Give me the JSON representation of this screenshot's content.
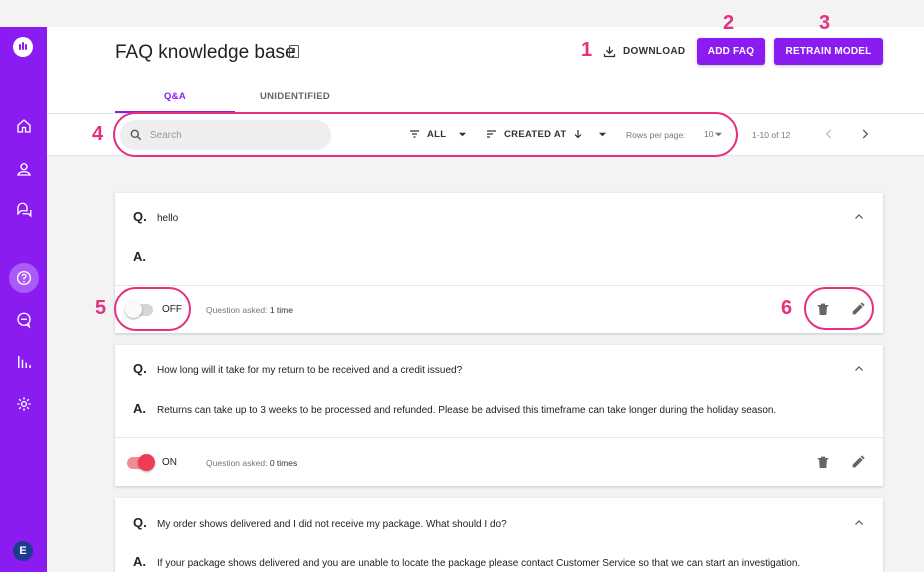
{
  "app": {
    "avatar_letter": "E"
  },
  "sidebar": {
    "items": [
      {
        "icon": "home-icon",
        "active": false
      },
      {
        "icon": "contacts-icon",
        "active": false
      },
      {
        "icon": "chats-icon",
        "active": false
      },
      {
        "icon": "faq-icon",
        "active": true
      },
      {
        "icon": "messages-icon",
        "active": false
      },
      {
        "icon": "analytics-icon",
        "active": false
      },
      {
        "icon": "settings-icon",
        "active": false
      }
    ]
  },
  "header": {
    "title": "FAQ knowledge base",
    "download_label": "DOWNLOAD",
    "add_faq_label": "ADD FAQ",
    "retrain_label": "RETRAIN MODEL"
  },
  "tabs": [
    {
      "label": "Q&A",
      "active": true
    },
    {
      "label": "UNIDENTIFIED",
      "active": false
    }
  ],
  "toolbar": {
    "search_placeholder": "Search",
    "filter_label": "ALL",
    "sort_label": "CREATED AT",
    "rows_per_page_label": "Rows per page:",
    "rows_per_page_value": "10",
    "range_label": "1-10 of 12"
  },
  "callouts": [
    "1",
    "2",
    "3",
    "4",
    "5",
    "6"
  ],
  "faqs": [
    {
      "q_label": "Q.",
      "question": "hello",
      "a_label": "A.",
      "answer": "",
      "enabled": false,
      "state_label": "OFF",
      "asked_label": "Question asked:",
      "asked_value": "1 time"
    },
    {
      "q_label": "Q.",
      "question": "How long will it take for my return to be received and a credit issued?",
      "a_label": "A.",
      "answer": "Returns can take up to 3 weeks to be processed and refunded. Please be advised this timeframe can take longer during the holiday season.",
      "enabled": true,
      "state_label": "ON",
      "asked_label": "Question asked:",
      "asked_value": "0 times"
    },
    {
      "q_label": "Q.",
      "question": "My order shows delivered and I did not receive my package. What should I do?",
      "a_label": "A.",
      "answer": "If your package shows delivered and you are unable to locate the package please contact Customer Service so that we can start an investigation."
    }
  ],
  "colors": {
    "brand": "#8a1cf2",
    "annotation": "#e4307f",
    "toggle_on": "#ef3c52"
  }
}
